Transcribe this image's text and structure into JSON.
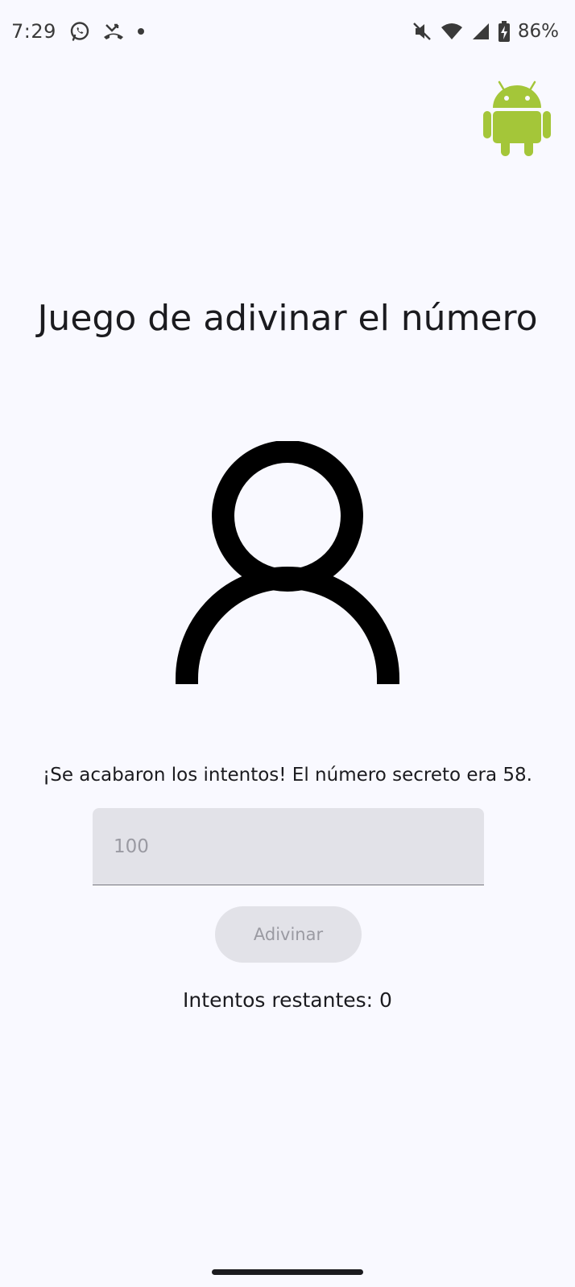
{
  "status_bar": {
    "time": "7:29",
    "battery": "86%",
    "icons": [
      "whatsapp-icon",
      "missed-call-icon",
      "notification-dot-icon",
      "vibrate-off-icon",
      "wifi-icon",
      "signal-icon",
      "battery-charging-icon"
    ]
  },
  "app": {
    "logo": "android-icon",
    "logo_color": "#a4c639",
    "title": "Juego de adivinar el número",
    "avatar": "person-icon"
  },
  "game": {
    "message": "¡Se acabaron los intentos! El número secreto era 58.",
    "input_value": "",
    "input_placeholder": "100",
    "guess_button_label": "Adivinar",
    "guess_button_enabled": false,
    "attempts_text": "Intentos restantes: 0"
  },
  "colors": {
    "background": "#f9f9ff",
    "disabled_surface": "#e2e2e8",
    "disabled_text": "#9a9aa2"
  }
}
